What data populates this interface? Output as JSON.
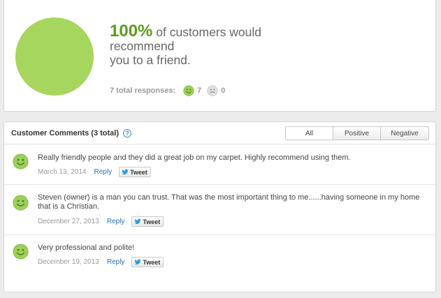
{
  "summary": {
    "percent": "100%",
    "headline_line1": " of customers would",
    "headline_line2": "recommend",
    "headline_line3": "you to a friend.",
    "responses_label": "7 total responses:",
    "positive_count": "7",
    "negative_count": "0",
    "recommend_fraction": 1.0
  },
  "comments_section": {
    "title": "Customer Comments (3 total)",
    "help_icon": "?",
    "filters": [
      {
        "label": "All",
        "active": true
      },
      {
        "label": "Positive",
        "active": false
      },
      {
        "label": "Negative",
        "active": false
      }
    ],
    "items": [
      {
        "sentiment_icon": "smiley-icon",
        "text": "Really friendly people and they did a great job on my carpet. Highly recommend using them.",
        "date": "March 13, 2014",
        "reply_label": "Reply",
        "tweet_label": "Tweet"
      },
      {
        "sentiment_icon": "smiley-icon",
        "text": "Steven (owner) is a man you can trust. That was the most important thing to me......having someone in my home that is a Christian.",
        "date": "December 27, 2013",
        "reply_label": "Reply",
        "tweet_label": "Tweet"
      },
      {
        "sentiment_icon": "smiley-icon",
        "text": "Very professional and polite!",
        "date": "December 19, 2013",
        "reply_label": "Reply",
        "tweet_label": "Tweet"
      }
    ]
  },
  "colors": {
    "accent_green": "#5d9b1d",
    "pie_green": "#a6d65e",
    "link_blue": "#2a6fb0",
    "muted_gray": "#999999"
  }
}
